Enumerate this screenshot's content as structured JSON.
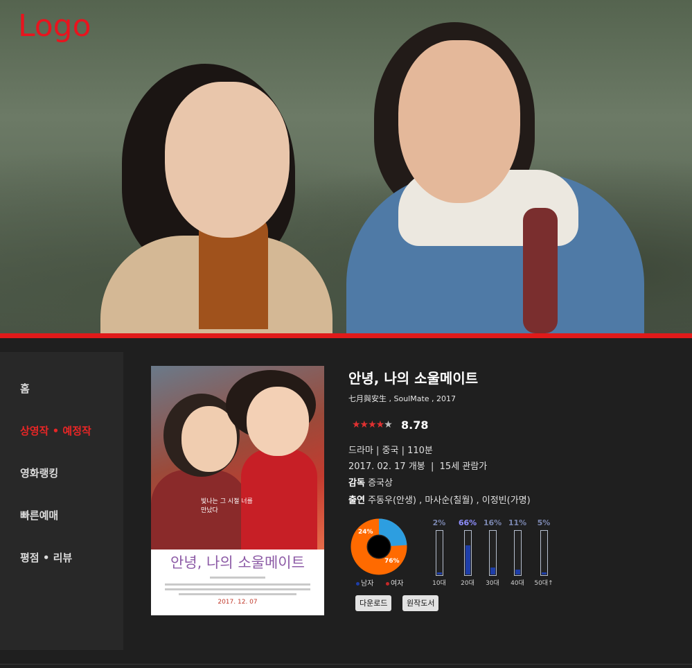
{
  "header": {
    "logo_text": "Logo"
  },
  "sidebar": {
    "items": [
      {
        "label": "홈",
        "active": false
      },
      {
        "label": "상영작 • 예정작",
        "active": true
      },
      {
        "label": "영화랭킹",
        "active": false
      },
      {
        "label": "빠른예매",
        "active": false
      },
      {
        "label": "평점 • 리뷰",
        "active": false
      }
    ]
  },
  "poster": {
    "title": "안녕, 나의 소울메이트",
    "tagline": "빛나는 그 시절 너를 만났다",
    "date": "2017. 12. 07"
  },
  "movie": {
    "title": "안녕, 나의 소울메이트",
    "subtitle": "七月與安生 , SoulMate , 2017",
    "stars": "★★★★",
    "star_half": "★",
    "rating_value": 4.5,
    "score": "8.78",
    "genre_line": "드라마 | 중국 | 110분",
    "release_line": "2017. 02. 17 개봉  |  15세 관람가",
    "director_label": "감독",
    "director": "증국상",
    "cast_label": "출연",
    "cast": "주동우(안생) , 마사순(칠월) , 이정빈(가명)"
  },
  "gender": {
    "male_pct_label": "24%",
    "female_pct_label": "76%",
    "male": 24,
    "female": 76,
    "male_label": "남자",
    "female_label": "여자",
    "male_color": "#2d9ee0",
    "female_color": "#ff6a00"
  },
  "age": [
    {
      "pct_label": "2%",
      "value": 2,
      "label": "10대"
    },
    {
      "pct_label": "66%",
      "value": 66,
      "label": "20대"
    },
    {
      "pct_label": "16%",
      "value": 16,
      "label": "30대"
    },
    {
      "pct_label": "11%",
      "value": 11,
      "label": "40대"
    },
    {
      "pct_label": "5%",
      "value": 5,
      "label": "50대↑"
    }
  ],
  "buttons": {
    "download": "다운로드",
    "original": "원작도서"
  },
  "colors": {
    "accent": "#e01a1a",
    "background": "#1f1f1f",
    "sidebar": "#282828"
  }
}
